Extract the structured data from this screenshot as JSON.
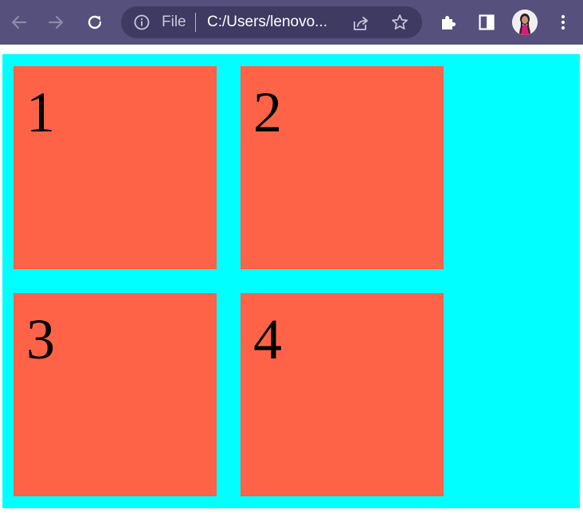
{
  "browser": {
    "back_icon": "arrow-left-icon",
    "forward_icon": "arrow-right-icon",
    "reload_icon": "reload-icon",
    "omnibox": {
      "info_icon": "info-icon",
      "scheme_label": "File",
      "url": "C:/Users/lenovo...",
      "share_icon": "share-icon",
      "bookmark_icon": "star-icon"
    },
    "extensions_icon": "puzzle-icon",
    "side_panel_icon": "side-panel-icon",
    "profile_icon": "avatar",
    "menu_icon": "kebab-menu-icon",
    "colors": {
      "frame": "#55507c",
      "omnibox": "#3f3a62"
    }
  },
  "page": {
    "colors": {
      "container_background": "#00ffff",
      "item_background": "#ff6347",
      "text": "#000000"
    },
    "grid_items": [
      {
        "label": "1"
      },
      {
        "label": "2"
      },
      {
        "label": "3"
      },
      {
        "label": "4"
      }
    ]
  }
}
